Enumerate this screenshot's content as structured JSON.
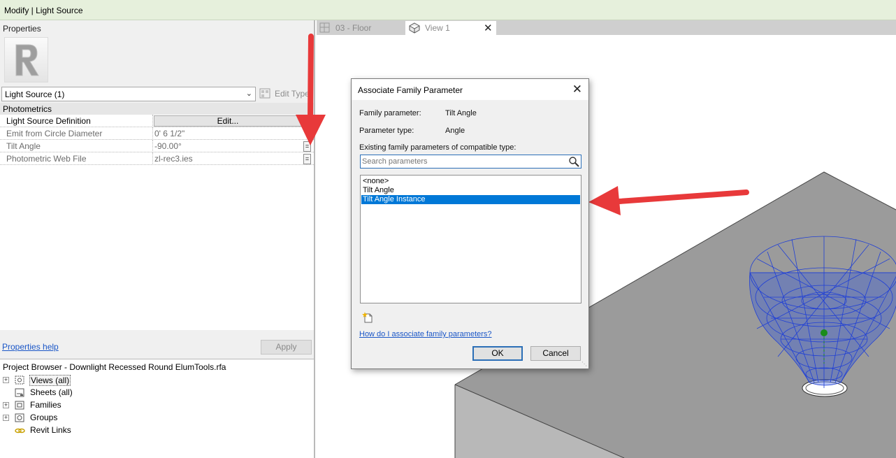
{
  "context_bar": {
    "label": "Modify | Light Source"
  },
  "properties": {
    "title": "Properties",
    "type_selector": "Light Source (1)",
    "edit_type": "Edit Type",
    "group": "Photometrics",
    "rows": [
      {
        "key": "Light Source Definition",
        "value": "Edit..."
      },
      {
        "key": "Emit from Circle Diameter",
        "value": "0'  6 1/2\""
      },
      {
        "key": "Tilt Angle",
        "value": "-90.00°"
      },
      {
        "key": "Photometric Web File",
        "value": "zl-rec3.ies"
      }
    ],
    "assoc_glyph": "=",
    "help_link": "Properties help",
    "apply": "Apply"
  },
  "project_browser": {
    "title": "Project Browser - Downlight Recessed Round ElumTools.rfa",
    "items": [
      {
        "label": "Views (all)",
        "icon": "views-icon",
        "expand": "+"
      },
      {
        "label": "Sheets (all)",
        "icon": "sheets-icon",
        "expand": ""
      },
      {
        "label": "Families",
        "icon": "families-icon",
        "expand": "+"
      },
      {
        "label": "Groups",
        "icon": "groups-icon",
        "expand": "+"
      },
      {
        "label": "Revit Links",
        "icon": "links-icon",
        "expand": ""
      }
    ]
  },
  "tabs": [
    {
      "label": "03 - Floor",
      "icon": "floor-plan-icon",
      "active": false
    },
    {
      "label": "View 1",
      "icon": "3d-view-icon",
      "active": true,
      "close": "✕"
    }
  ],
  "dialog": {
    "title": "Associate Family Parameter",
    "close": "✕",
    "family_parameter_label": "Family parameter:",
    "family_parameter_value": "Tilt Angle",
    "parameter_type_label": "Parameter type:",
    "parameter_type_value": "Angle",
    "existing_label": "Existing family parameters of compatible type:",
    "search_placeholder": "Search parameters",
    "list": [
      "<none>",
      "Tilt Angle",
      "Tilt Angle Instance"
    ],
    "selected_index": 2,
    "help_link": "How do I associate family parameters?",
    "ok": "OK",
    "cancel": "Cancel"
  },
  "colors": {
    "accent": "#0078d7",
    "arrow": "#e8393a",
    "wireframe": "#1f3fd6",
    "slab": "#9a9a9a"
  }
}
